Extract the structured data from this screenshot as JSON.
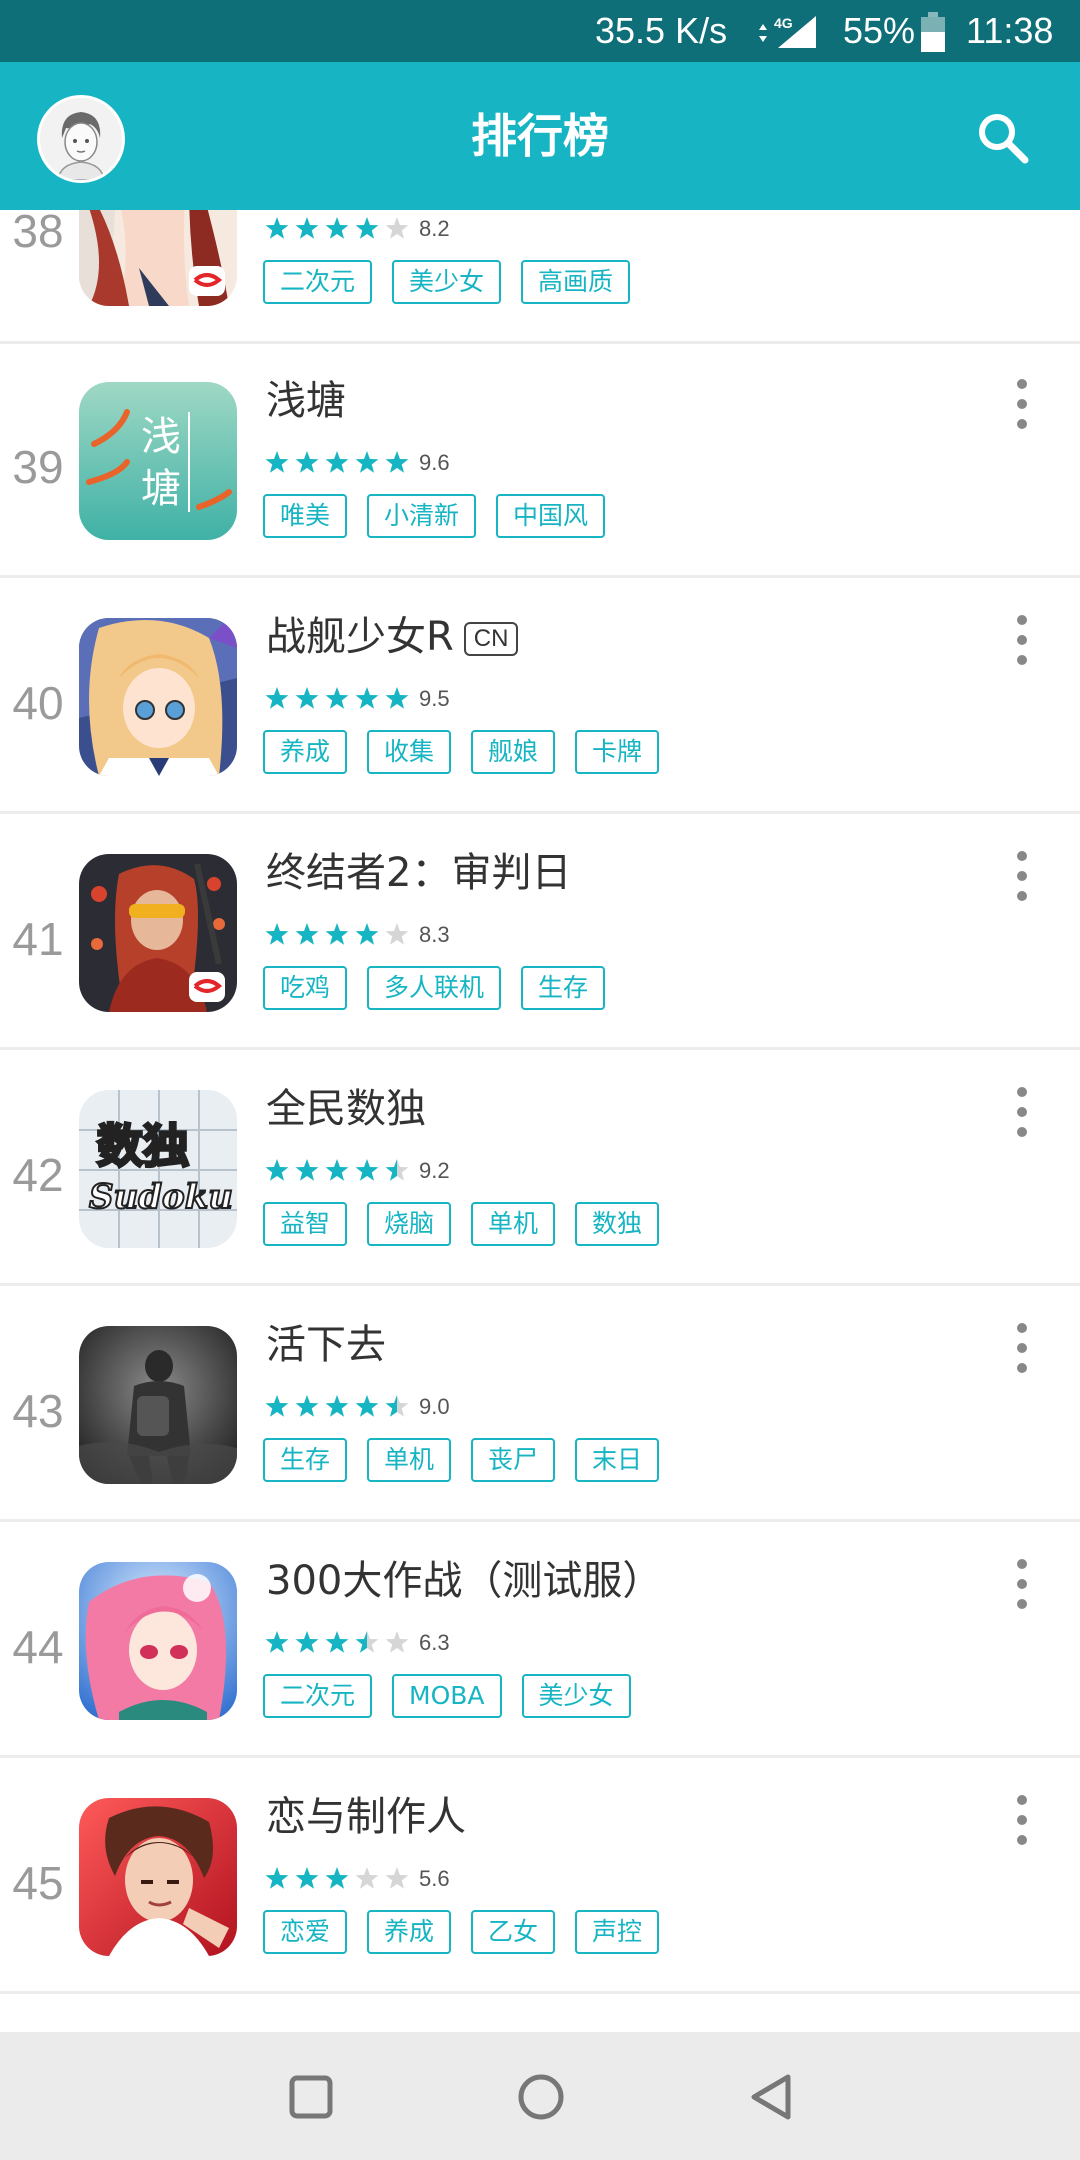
{
  "status_bar": {
    "network_speed": "35.5 K/s",
    "network_type": "4G",
    "battery": "55%",
    "time": "11:38"
  },
  "app_bar": {
    "title": "排行榜"
  },
  "colors": {
    "accent": "#17b5c3",
    "status_bar": "#0f6f78",
    "star_on": "#17b5c3",
    "star_off": "#d6d6d6"
  },
  "rows": [
    {
      "rank": "38",
      "name": "",
      "score": "8.2",
      "stars": 4,
      "tags": [
        "二次元",
        "美少女",
        "高画质"
      ],
      "icon": "anime-girl-icon"
    },
    {
      "rank": "39",
      "name": "浅塘",
      "score": "9.6",
      "stars": 4.8,
      "tags": [
        "唯美",
        "小清新",
        "中国风"
      ],
      "icon": "qiantang-icon",
      "icon_text": [
        "浅",
        "塘"
      ]
    },
    {
      "rank": "40",
      "name": "战舰少女R",
      "badge": "CN",
      "score": "9.5",
      "stars": 4.8,
      "tags": [
        "养成",
        "收集",
        "舰娘",
        "卡牌"
      ],
      "icon": "warship-girl-icon"
    },
    {
      "rank": "41",
      "name": "终结者2：审判日",
      "score": "8.3",
      "stars": 4,
      "tags": [
        "吃鸡",
        "多人联机",
        "生存"
      ],
      "icon": "terminator-icon"
    },
    {
      "rank": "42",
      "name": "全民数独",
      "score": "9.2",
      "stars": 4.5,
      "tags": [
        "益智",
        "烧脑",
        "单机",
        "数独"
      ],
      "icon": "sudoku-icon",
      "icon_text": [
        "数独",
        "Sudoku"
      ]
    },
    {
      "rank": "43",
      "name": "活下去",
      "score": "9.0",
      "stars": 4.5,
      "tags": [
        "生存",
        "单机",
        "丧尸",
        "末日"
      ],
      "icon": "survivor-icon"
    },
    {
      "rank": "44",
      "name": "300大作战（测试服）",
      "score": "6.3",
      "stars": 3.5,
      "tags": [
        "二次元",
        "MOBA",
        "美少女"
      ],
      "icon": "pink-hair-girl-icon"
    },
    {
      "rank": "45",
      "name": "恋与制作人",
      "score": "5.6",
      "stars": 3,
      "tags": [
        "恋爱",
        "养成",
        "乙女",
        "声控"
      ],
      "icon": "love-producer-icon"
    }
  ],
  "nav_bar": {
    "recent": "recents-square-icon",
    "home": "home-circle-icon",
    "back": "back-triangle-icon"
  }
}
